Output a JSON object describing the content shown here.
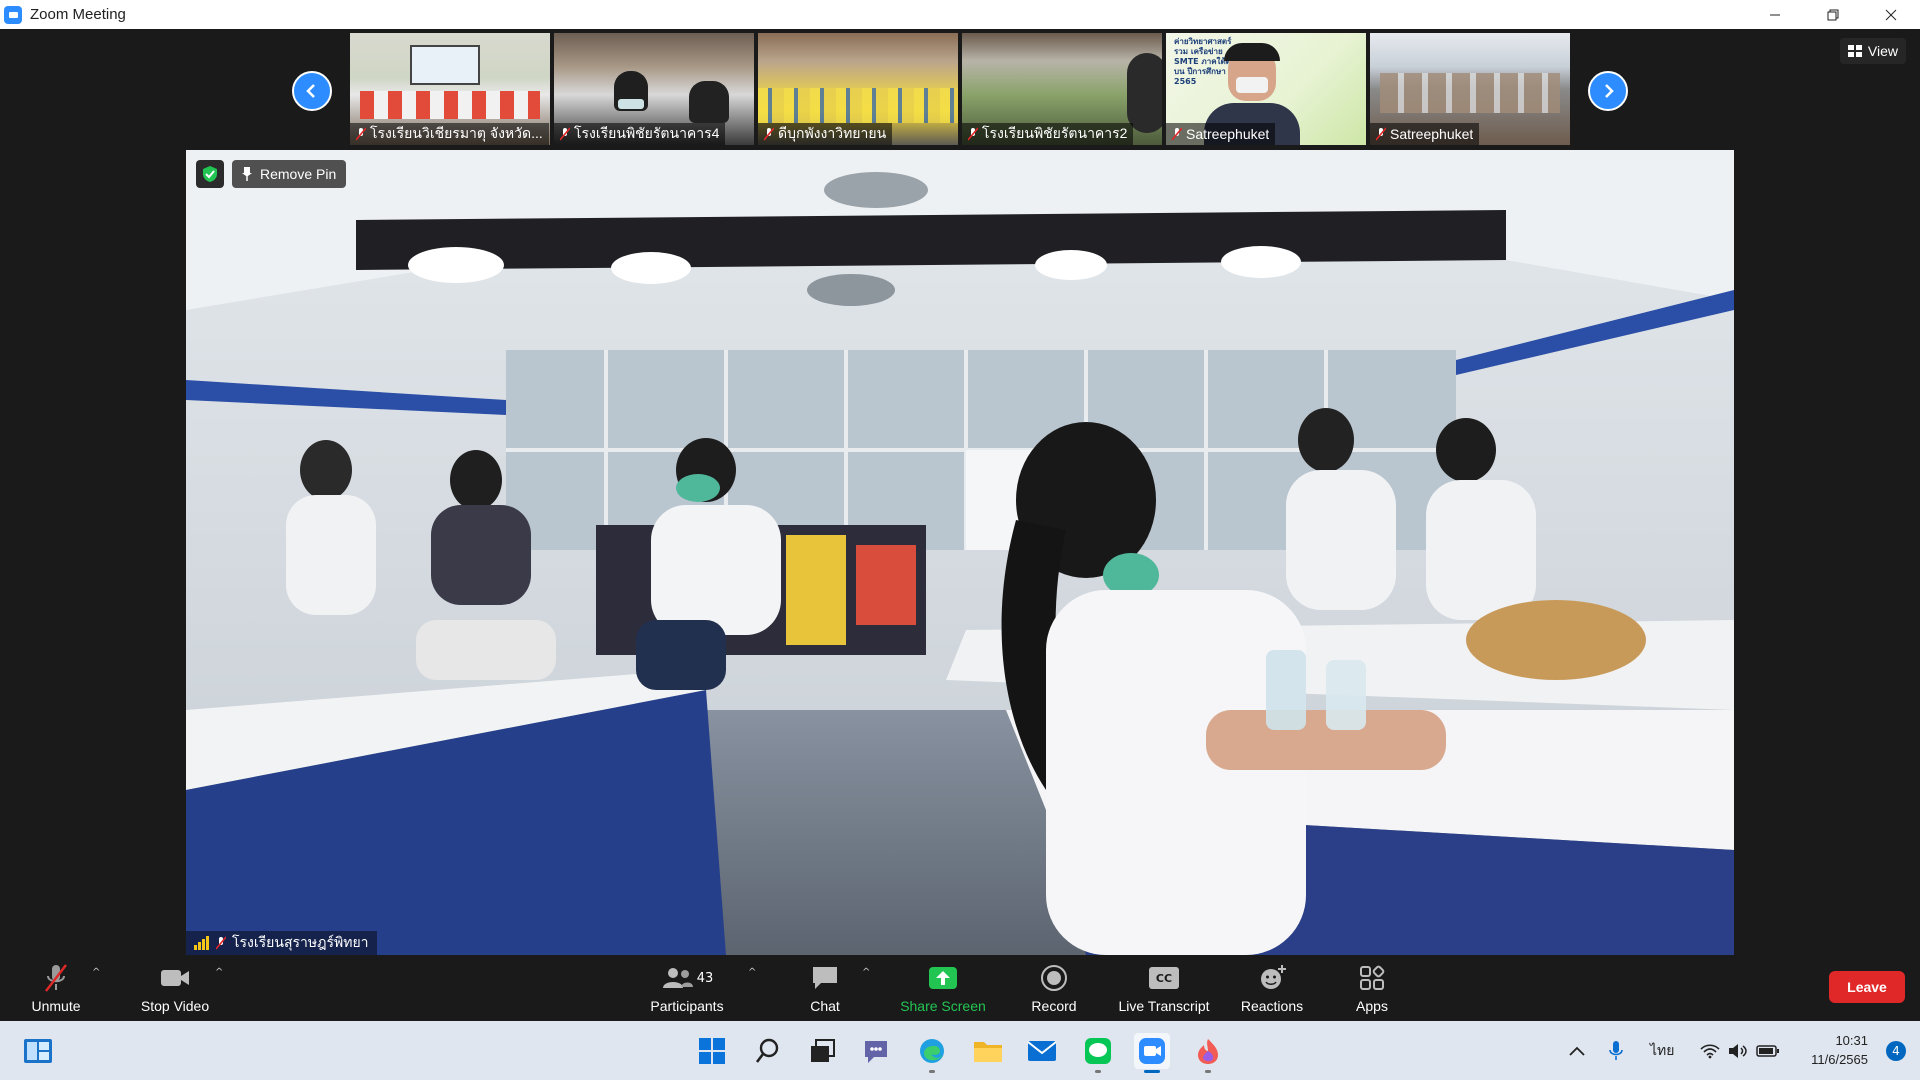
{
  "window": {
    "title": "Zoom Meeting",
    "controls": [
      "minimize",
      "restore",
      "close"
    ]
  },
  "gallery": {
    "view_label": "View",
    "thumbnails": [
      {
        "name": "โรงเรียนวิเชียรมาตุ จังหวัด..."
      },
      {
        "name": "โรงเรียนพิชัยรัตนาคาร4"
      },
      {
        "name": "ดีบุกพังงาวิทยายน"
      },
      {
        "name": "โรงเรียนพิชัยรัตนาคาร2"
      },
      {
        "name": "Satreephuket"
      },
      {
        "name": "Satreephuket"
      }
    ],
    "thumb4_slide_text": "ค่ายวิทยาศาสตร์รวม เครือข่าย SMTE ภาคใต้ตอนบน ปีการศึกษา 2565"
  },
  "main_video": {
    "pin_button": "Remove Pin",
    "speaker_name": "โรงเรียนสุราษฎร์พิทยา"
  },
  "toolbar": {
    "unmute": "Unmute",
    "stop_video": "Stop Video",
    "participants": "Participants",
    "participants_count": "43",
    "chat": "Chat",
    "share_screen": "Share Screen",
    "record": "Record",
    "live_transcript": "Live Transcript",
    "cc_badge": "CC",
    "reactions": "Reactions",
    "apps": "Apps",
    "leave": "Leave"
  },
  "taskbar": {
    "language": "ไทย",
    "time": "10:31",
    "date": "11/6/2565",
    "notifications": "4"
  },
  "colors": {
    "accent": "#2d8cff",
    "leave": "#e02828",
    "share_green": "#23c552"
  }
}
